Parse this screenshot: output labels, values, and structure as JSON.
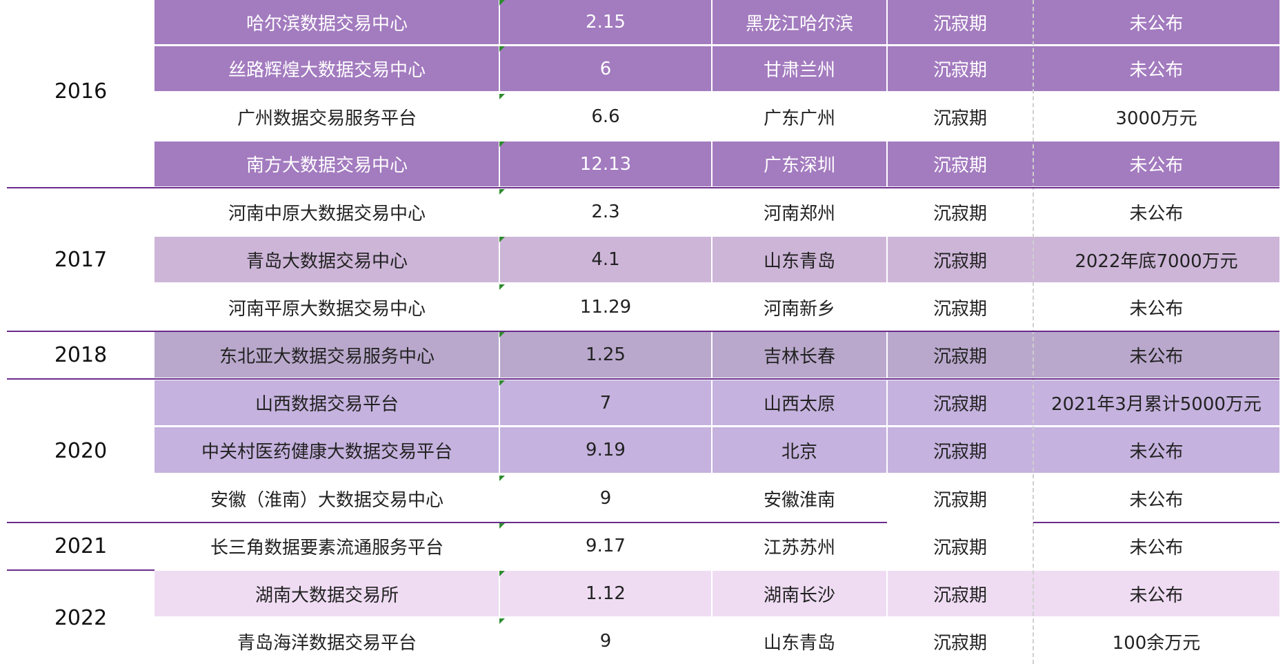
{
  "colors": {
    "row_purple_dark": "#a37bbf",
    "row_lilac": "#cdb5d8",
    "row_grey_purple": "#b9a8cc",
    "row_mauve": "#c5b2de",
    "row_light_pink": "#efdcf3",
    "divider": "#6a2b8c",
    "comment_marker": "#2e8b2e"
  },
  "groups": [
    {
      "year": "2016"
    },
    {
      "year": "2017"
    },
    {
      "year": "2018"
    },
    {
      "year": "2020"
    },
    {
      "year": "2021"
    },
    {
      "year": "2022"
    }
  ],
  "rows": [
    {
      "name": "哈尔滨数据交易中心",
      "date": "2.15",
      "location": "黑龙江哈尔滨",
      "stage": "沉寂期",
      "revenue": "未公布"
    },
    {
      "name": "丝路辉煌大数据交易中心",
      "date": "6",
      "location": "甘肃兰州",
      "stage": "沉寂期",
      "revenue": "未公布"
    },
    {
      "name": "广州数据交易服务平台",
      "date": "6.6",
      "location": "广东广州",
      "stage": "沉寂期",
      "revenue": "3000万元"
    },
    {
      "name": "南方大数据交易中心",
      "date": "12.13",
      "location": "广东深圳",
      "stage": "沉寂期",
      "revenue": "未公布"
    },
    {
      "name": "河南中原大数据交易中心",
      "date": "2.3",
      "location": "河南郑州",
      "stage": "沉寂期",
      "revenue": "未公布"
    },
    {
      "name": "青岛大数据交易中心",
      "date": "4.1",
      "location": "山东青岛",
      "stage": "沉寂期",
      "revenue": "2022年底7000万元"
    },
    {
      "name": "河南平原大数据交易中心",
      "date": "11.29",
      "location": "河南新乡",
      "stage": "沉寂期",
      "revenue": "未公布"
    },
    {
      "name": "东北亚大数据交易服务中心",
      "date": "1.25",
      "location": "吉林长春",
      "stage": "沉寂期",
      "revenue": "未公布"
    },
    {
      "name": "山西数据交易平台",
      "date": "7",
      "location": "山西太原",
      "stage": "沉寂期",
      "revenue": "2021年3月累计5000万元"
    },
    {
      "name": "中关村医药健康大数据交易平台",
      "date": "9.19",
      "location": "北京",
      "stage": "沉寂期",
      "revenue": "未公布"
    },
    {
      "name": "安徽（淮南）大数据交易中心",
      "date": "9",
      "location": "安徽淮南",
      "stage": "沉寂期",
      "revenue": "未公布"
    },
    {
      "name": "长三角数据要素流通服务平台",
      "date": "9.17",
      "location": "江苏苏州",
      "stage": "沉寂期",
      "revenue": "未公布"
    },
    {
      "name": "湖南大数据交易所",
      "date": "1.12",
      "location": "湖南长沙",
      "stage": "沉寂期",
      "revenue": "未公布"
    },
    {
      "name": "青岛海洋数据交易平台",
      "date": "9",
      "location": "山东青岛",
      "stage": "沉寂期",
      "revenue": "100余万元"
    }
  ]
}
